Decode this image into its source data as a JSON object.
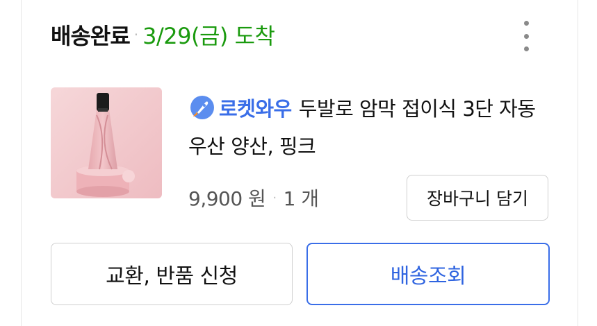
{
  "order": {
    "status": "배송완료",
    "separator": "·",
    "arrival": "3/29(금) 도착",
    "menu_icon": "more-vertical-icon"
  },
  "product": {
    "badge_icon": "rocket-icon",
    "badge_label": "로켓와우",
    "name": "두발로 암막 접이식 3단 자동 우산 양산, 핑크",
    "price": "9,900 원",
    "price_separator": "·",
    "quantity": "1 개",
    "image_desc_colors": {
      "background": "#f2c9cc",
      "umbrella": "#eab3b8",
      "handle": "#1a1a1a"
    }
  },
  "actions": {
    "add_to_cart": "장바구니 담기",
    "exchange_return": "교환, 반품 신청",
    "track_delivery": "배송조회"
  },
  "colors": {
    "arrival_green": "#1a9a0e",
    "accent_blue": "#3a6ee8",
    "border_gray": "#cfcfcf"
  }
}
